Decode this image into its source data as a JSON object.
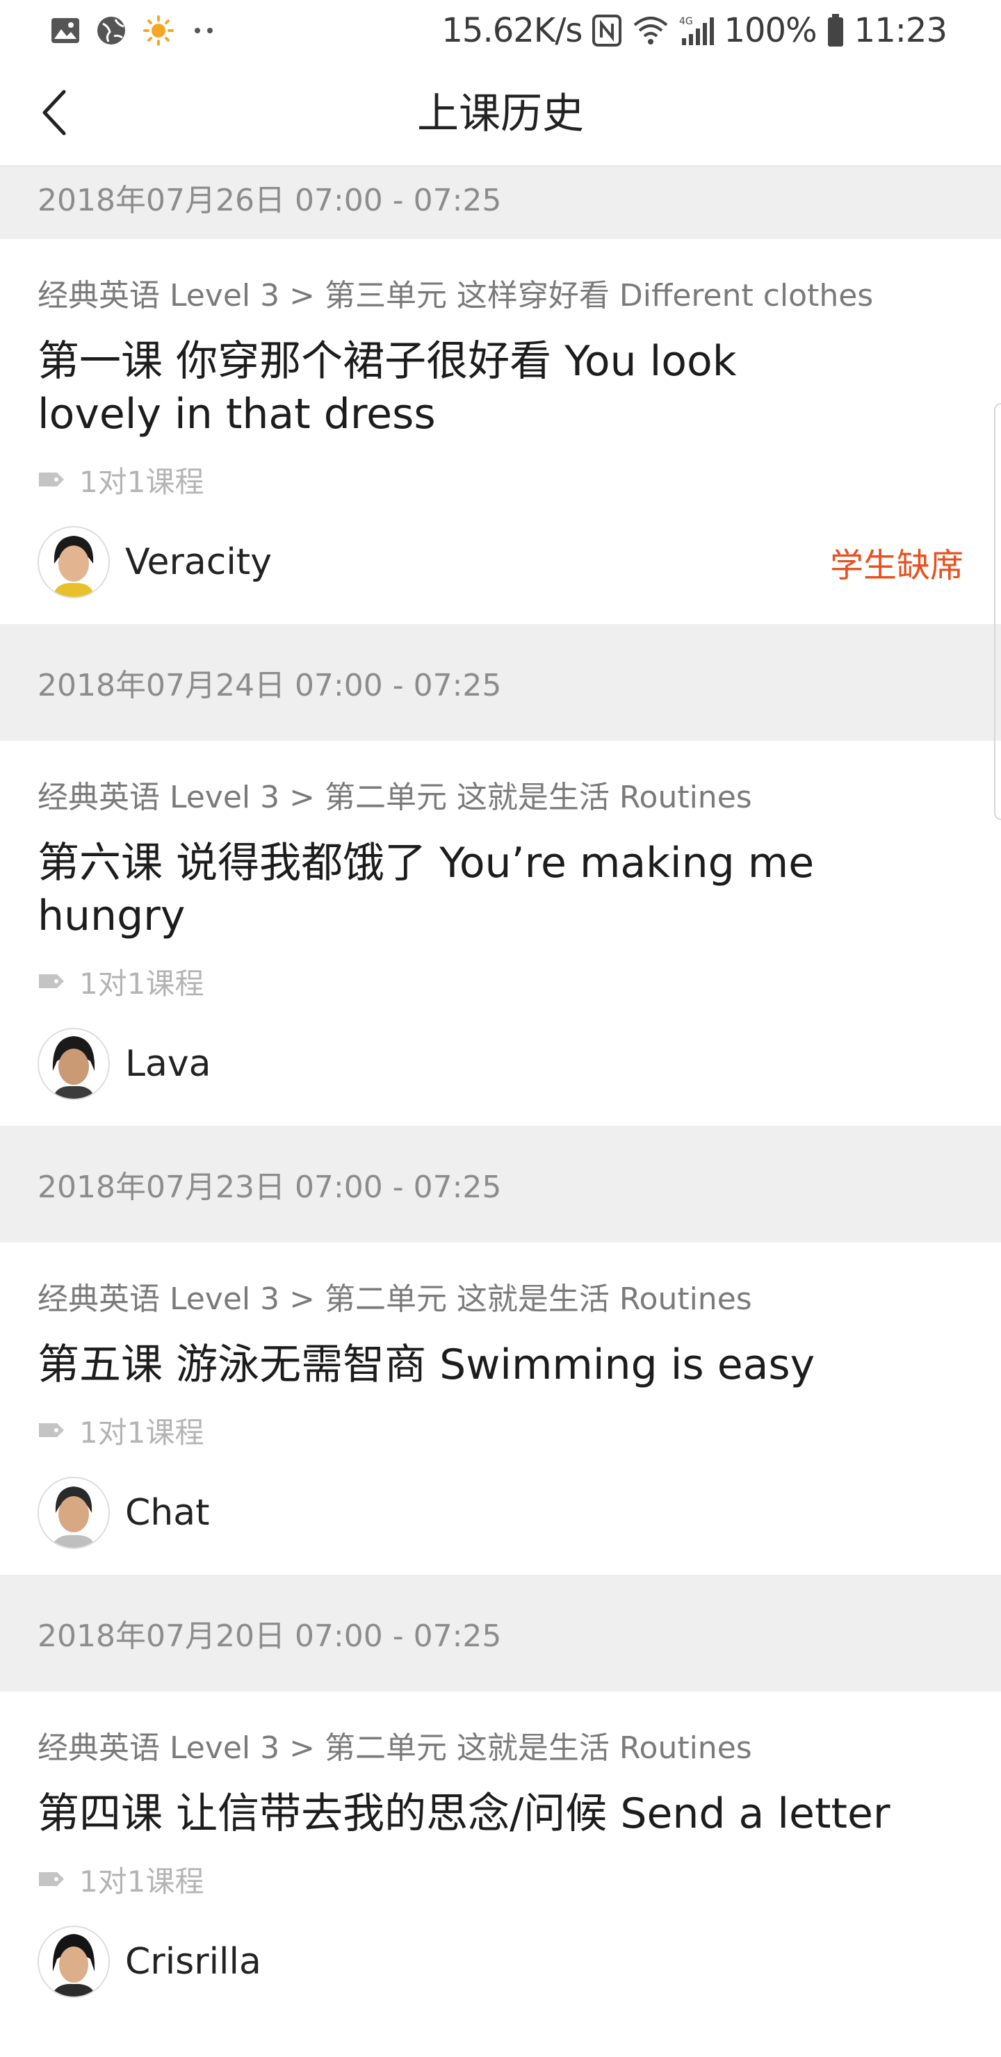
{
  "status_bar": {
    "network_speed": "15.62K/s",
    "battery": "100%",
    "time": "11:23",
    "icons_left": [
      "gallery-icon",
      "globe-icon",
      "weather-sun-icon",
      "more-dots-icon"
    ],
    "icons_right": [
      "nfc-icon",
      "wifi-icon",
      "signal-4g-icon",
      "battery-icon"
    ]
  },
  "header": {
    "title": "上课历史",
    "back_icon": "chevron-left-icon"
  },
  "classes": [
    {
      "date": "2018年07月26日 07:00 - 07:25",
      "course_path": "经典英语 Level 3 > 第三单元 这样穿好看 Different clothes",
      "lesson_title": "第一课 你穿那个裙子很好看 You look lovely in that dress",
      "tag": "1对1课程",
      "teacher": "Veracity",
      "status": "学生缺席"
    },
    {
      "date": "2018年07月24日 07:00 - 07:25",
      "course_path": "经典英语 Level 3 > 第二单元 这就是生活 Routines",
      "lesson_title": "第六课 说得我都饿了 You’re making me hungry",
      "tag": "1对1课程",
      "teacher": "Lava"
    },
    {
      "date": "2018年07月23日 07:00 - 07:25",
      "course_path": "经典英语 Level 3 > 第二单元 这就是生活 Routines",
      "lesson_title": "第五课 游泳无需智商 Swimming is easy",
      "tag": "1对1课程",
      "teacher": "Chat"
    },
    {
      "date": "2018年07月20日 07:00 - 07:25",
      "course_path": "经典英语 Level 3 > 第二单元 这就是生活 Routines",
      "lesson_title": "第四课 让信带去我的思念/问候 Send a letter",
      "tag": "1对1课程",
      "teacher": "Crisrilla"
    }
  ],
  "colors": {
    "accent_absent": "#e8501e",
    "date_bar_bg": "#efefef",
    "muted_text": "#8c8c8c"
  }
}
